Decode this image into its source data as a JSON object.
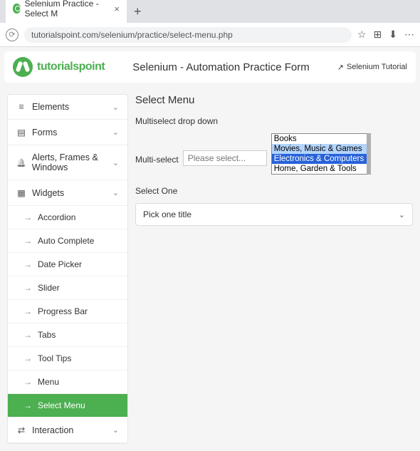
{
  "browser": {
    "tab_title": "Selenium Practice - Select M",
    "url": "tutorialspoint.com/selenium/practice/select-menu.php"
  },
  "header": {
    "logo_text": "tutorialspoint",
    "page_title": "Selenium - Automation Practice Form",
    "tutorial_link": "Selenium Tutorial"
  },
  "sidebar": {
    "categories": [
      {
        "label": "Elements",
        "icon": "ham"
      },
      {
        "label": "Forms",
        "icon": "formico"
      },
      {
        "label": "Alerts, Frames & Windows",
        "icon": "bell"
      },
      {
        "label": "Widgets",
        "icon": "grid4",
        "expanded": true
      },
      {
        "label": "Interaction",
        "icon": "swap"
      }
    ],
    "widget_items": [
      {
        "label": "Accordion"
      },
      {
        "label": "Auto Complete"
      },
      {
        "label": "Date Picker"
      },
      {
        "label": "Slider"
      },
      {
        "label": "Progress Bar"
      },
      {
        "label": "Tabs"
      },
      {
        "label": "Tool Tips"
      },
      {
        "label": "Menu"
      },
      {
        "label": "Select Menu",
        "active": true
      }
    ]
  },
  "main": {
    "section_title": "Select Menu",
    "multiselect_heading": "Multiselect drop down",
    "multiselect_label": "Multi-select",
    "multiselect_placeholder": "Please select...",
    "multiselect_options": [
      {
        "text": "Books",
        "state": "none"
      },
      {
        "text": "Movies, Music & Games",
        "state": "hl"
      },
      {
        "text": "Electronics & Computers",
        "state": "sel"
      },
      {
        "text": "Home, Garden & Tools",
        "state": "none"
      }
    ],
    "select_one_heading": "Select One",
    "select_one_value": "Pick one title"
  }
}
